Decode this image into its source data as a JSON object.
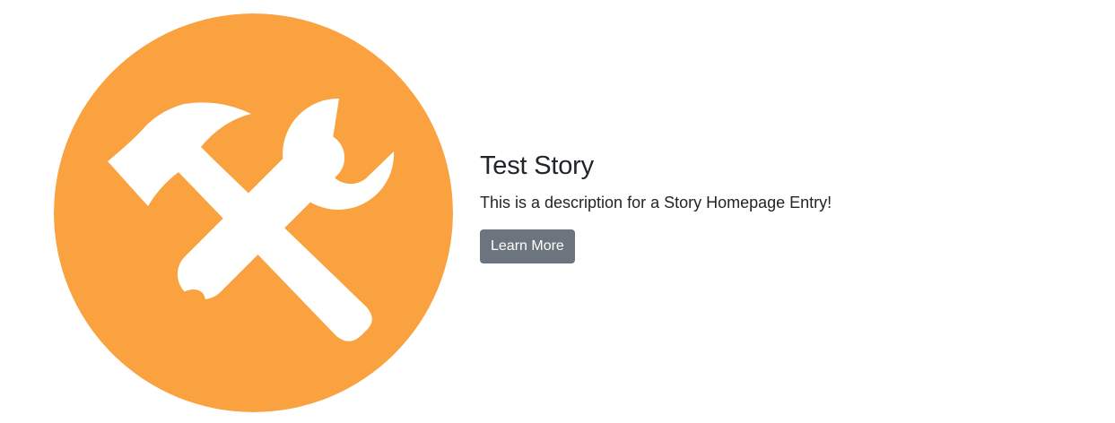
{
  "story": {
    "image_icon": "hammer-and-wrench-icon",
    "icon_background_color": "#F9A23F",
    "icon_foreground_color": "#FFFFFF",
    "title": "Test Story",
    "description": "This is a description for a Story Homepage Entry!",
    "button_label": "Learn More",
    "button_color": "#6C757D"
  }
}
